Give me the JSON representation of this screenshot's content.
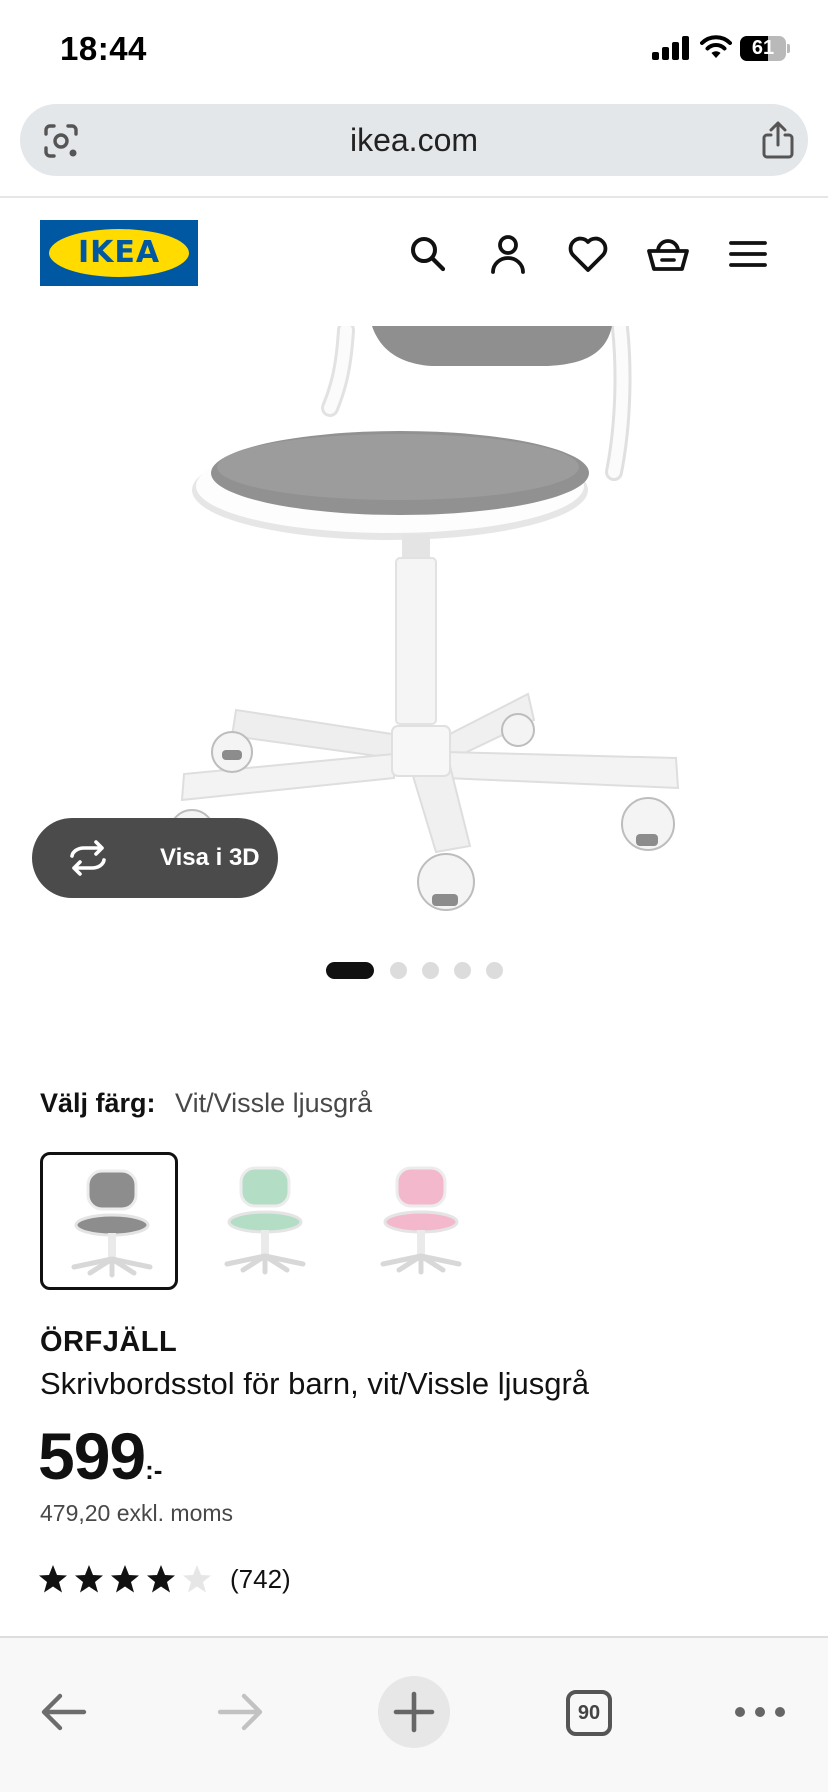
{
  "status_bar": {
    "time": "18:44",
    "battery_percent": "61",
    "signal_bars": 4,
    "icons": [
      "signal-icon",
      "wifi-icon",
      "battery-icon"
    ]
  },
  "browser": {
    "url": "ikea.com",
    "icons": [
      "lens-icon",
      "share-icon"
    ]
  },
  "header": {
    "logo_text": "IKEA",
    "icons": [
      "search-icon",
      "account-icon",
      "wishlist-icon",
      "cart-icon",
      "menu-icon"
    ]
  },
  "gallery": {
    "view_3d_label": "Visa i 3D",
    "total_images": 5,
    "active_index": 0
  },
  "color_picker": {
    "label": "Välj färg:",
    "selected_value": "Vit/Vissle ljusgrå",
    "options": [
      {
        "seat_color": "#8d8d8d",
        "selected": true
      },
      {
        "seat_color": "#b4ddc6",
        "selected": false
      },
      {
        "seat_color": "#f4b8cc",
        "selected": false
      }
    ]
  },
  "product": {
    "name": "ÖRFJÄLL",
    "description": "Skrivbordsstol för barn, vit/Vissle ljusgrå",
    "price": "599",
    "price_suffix": ":-",
    "price_excl_vat": "479,20 exkl. moms",
    "rating_filled_stars": 4,
    "rating_max_stars": 5,
    "reviews_count": "(742)"
  },
  "toolbar": {
    "tabs_count": "90",
    "icons": [
      "back-arrow-icon",
      "forward-arrow-icon",
      "new-tab-icon",
      "tabs-icon",
      "more-icon"
    ]
  },
  "colors": {
    "ikea_blue": "#0058a3",
    "ikea_yellow": "#ffdb00",
    "button_dark": "#4b4b4b",
    "address_bar_bg": "#e4e7ea"
  }
}
